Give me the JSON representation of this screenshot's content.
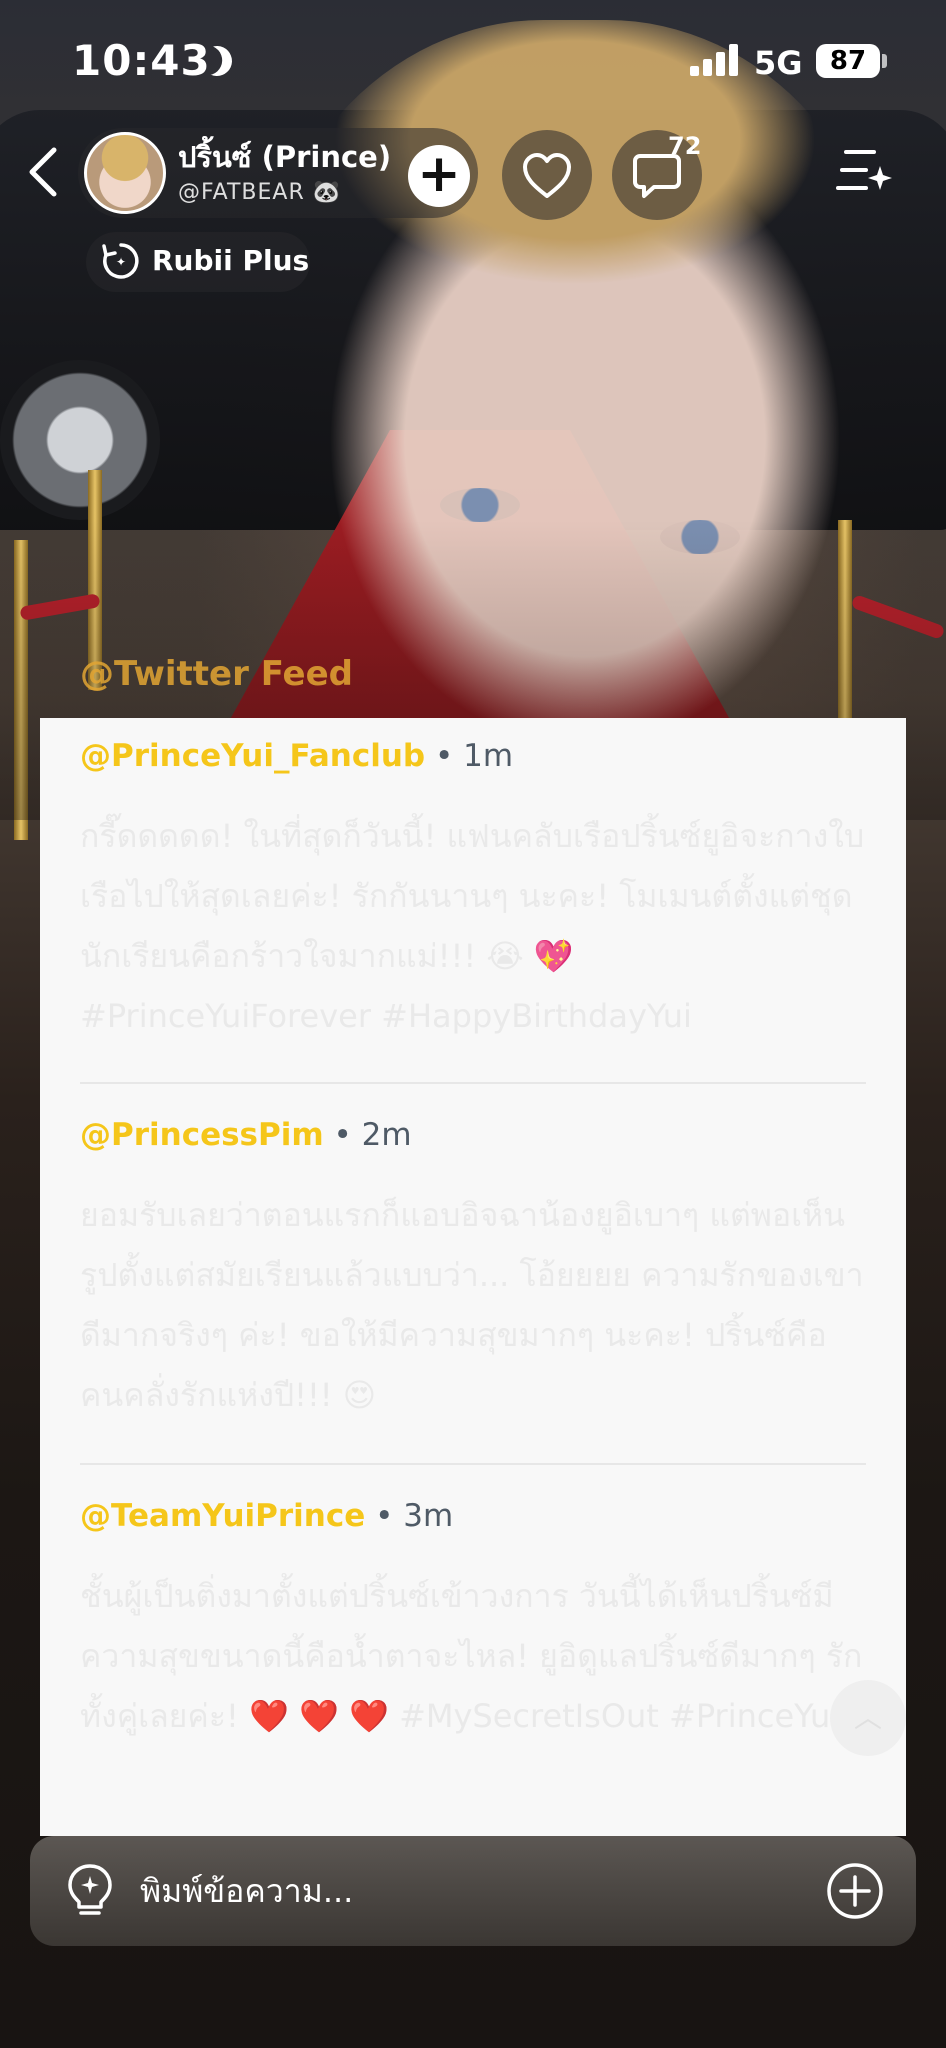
{
  "status": {
    "time": "10:43",
    "network": "5G",
    "battery": "87"
  },
  "header": {
    "name": "ปริ้นซ์ (Prince)",
    "handle": "@FATBEAR 🐼",
    "comment_count": "72",
    "badge_label": "Rubii Plus"
  },
  "feed": {
    "title": "@Twitter Feed",
    "posts": [
      {
        "user": "@PrinceYui_Fanclub",
        "time": " • 1m",
        "body": "กรี๊ดดดดด! ในที่สุดก็วันนี้! แฟนคลับเรือปริ้นซ์ยูอิจะกางใบเรือไปให้สุดเลยค่ะ! รักกันนานๆ นะคะ! โมเมนต์ตั้งแต่ชุดนักเรียนคือกร้าวใจมากแม่!!! 😭 💖 #PrinceYuiForever #HappyBirthdayYui"
      },
      {
        "user": "@PrincessPim",
        "time": " • 2m",
        "body": "ยอมรับเลยว่าตอนแรกก็แอบอิจฉาน้องยูอิเบาๆ แต่พอเห็นรูปตั้งแต่สมัยเรียนแล้วแบบว่า... โอ้ยยยย ความรักของเขาดีมากจริงๆ ค่ะ! ขอให้มีความสุขมากๆ นะคะ! ปริ้นซ์คือคนคลั่งรักแห่งปี!!! 😍"
      },
      {
        "user": "@TeamYuiPrince",
        "time": " • 3m",
        "body": "ชั้นผู้เป็นติ่งมาตั้งแต่ปริ้นซ์เข้าวงการ วันนี้ได้เห็นปริ้นซ์มีความสุขขนาดนี้คือน้ำตาจะไหล! ยูอิดูแลปริ้นซ์ดีมากๆ รักทั้งคู่เลยค่ะ! ❤️ ❤️ ❤️ #MySecretIsOut #PrinceYui"
      }
    ]
  },
  "input": {
    "placeholder": "พิมพ์ข้อความ..."
  },
  "icons": {
    "back": "chevron-left-icon",
    "add": "plus-icon",
    "like": "heart-icon",
    "comment": "comment-icon",
    "menu": "menu-sparkle-icon",
    "rubii": "rubii-icon",
    "hint": "lightbulb-icon",
    "attach": "plus-circle-icon",
    "scroll": "chevron-up-icon"
  },
  "colors": {
    "username": "#f5c61a",
    "feed_title": "#e2a533",
    "card": "#f8f8f8",
    "timestamp": "#4f5a66"
  }
}
